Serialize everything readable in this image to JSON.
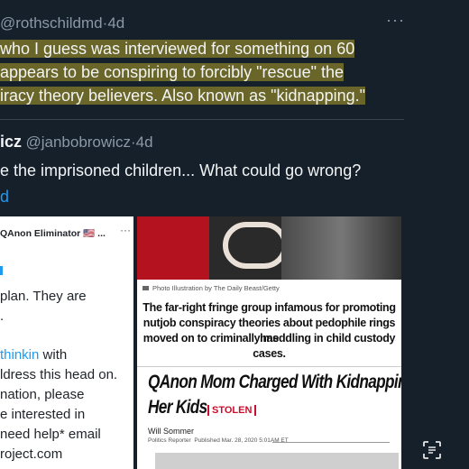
{
  "tweet1": {
    "handle": "@rothschildmd",
    "time": "4d",
    "more": "···",
    "lines": [
      "who I guess was interviewed for something on 60",
      "appears to be conspiring to forcibly \"rescue\" the",
      "iracy theory believers. Also known as \"kidnapping.\""
    ]
  },
  "tweet2": {
    "name_fragment": "icz",
    "handle": "@janbobrowicz",
    "time": "4d",
    "line": "e the imprisoned children... What could go wrong?",
    "link_fragment": "d"
  },
  "embed_left": {
    "account": "QAnon Eliminator",
    "flag": "🇺🇸",
    "ellipsis": "...",
    "more": "···",
    "line1": "plan. They are",
    "line2": ".",
    "mention": "thinkin",
    "mention_tail": " with",
    "line3": "ldress this head on.",
    "line4": "nation, please",
    "line5": "e interested in",
    "line6": "need help* email",
    "line7": "roject.com"
  },
  "embed_right": {
    "photo_credit": "Photo Illustration by The Daily Beast/Getty",
    "caption_lines": [
      "The far-right fringe group infamous for promoting",
      "nutjob conspiracy theories about pedophile rings has",
      "moved on to criminally meddling in child custody",
      "cases."
    ],
    "headline_line1": "QAnon Mom Charged With Kidnapping",
    "headline_line2": "Her Kids",
    "stolen_tag": "STOLEN",
    "author": "Will Sommer",
    "role": "Politics Reporter",
    "published": "Published Mar. 28, 2020 5:01AM ET"
  },
  "colors": {
    "background": "#15202b",
    "text": "#f2f4f5",
    "muted": "#8b98a5",
    "link": "#1d9bf0",
    "highlight": "#b0a028",
    "stolen_red": "#c8102e"
  }
}
